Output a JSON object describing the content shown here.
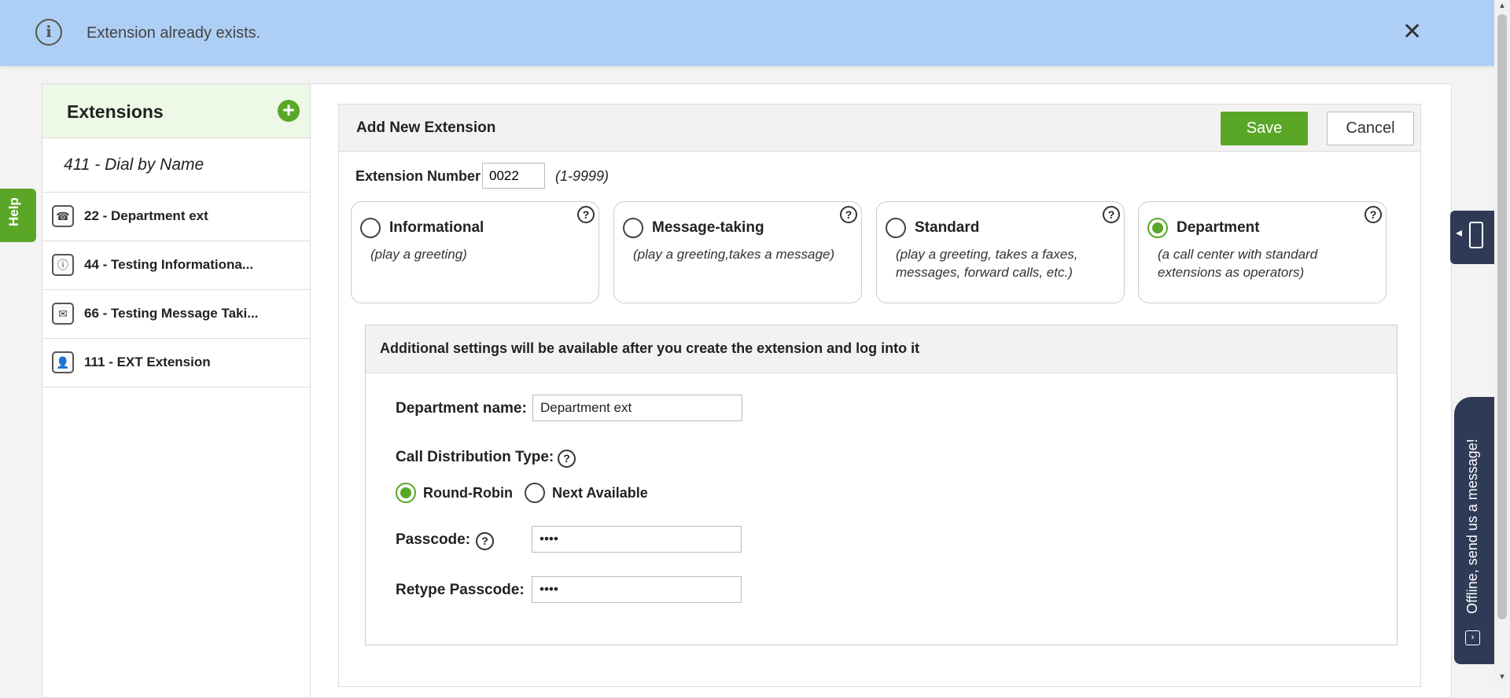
{
  "notification": {
    "message": "Extension already exists.",
    "info_icon": "info-icon",
    "close_icon": "close-icon"
  },
  "sidebar": {
    "title": "Extensions",
    "add_icon": "plus-circle-icon",
    "items": [
      {
        "label": "411 - Dial by Name"
      },
      {
        "label": "22 - Department ext",
        "icon": "department-phone-icon"
      },
      {
        "label": "44 - Testing Informationa...",
        "icon": "info-icon"
      },
      {
        "label": "66 - Testing Message Taki...",
        "icon": "message-taking-icon"
      },
      {
        "label": "111 - EXT Extension",
        "icon": "user-extension-icon"
      }
    ]
  },
  "help_tab": {
    "label": "Help"
  },
  "form": {
    "title": "Add New Extension",
    "save_label": "Save",
    "cancel_label": "Cancel",
    "ext_number_label": "Extension Number",
    "ext_number_value": "0022",
    "ext_number_range": "(1-9999)",
    "types": [
      {
        "name": "Informational",
        "desc": "(play a greeting)",
        "selected": false
      },
      {
        "name": "Message-taking",
        "desc": "(play a greeting,takes a message)",
        "selected": false
      },
      {
        "name": "Standard",
        "desc": "(play a greeting, takes a faxes, messages, forward calls, etc.)",
        "selected": false
      },
      {
        "name": "Department",
        "desc": "(a call center with standard extensions as operators)",
        "selected": true
      }
    ],
    "settings": {
      "header": "Additional settings will be available after you create the extension and log into it",
      "dept_name_label": "Department name:",
      "dept_name_value": "Department ext",
      "call_dist_label": "Call Distribution Type:",
      "round_robin_label": "Round-Robin",
      "next_available_label": "Next Available",
      "call_dist_selected": "Round-Robin",
      "passcode_label": "Passcode:",
      "passcode_value": "••••",
      "retype_passcode_label": "Retype Passcode:",
      "retype_passcode_value": "••••"
    }
  },
  "chat_widget": {
    "label": "Offline, send us a message!"
  },
  "colors": {
    "accent": "#5aa728",
    "notice_bg": "#aecff5",
    "widget_bg": "#2f3a56"
  }
}
